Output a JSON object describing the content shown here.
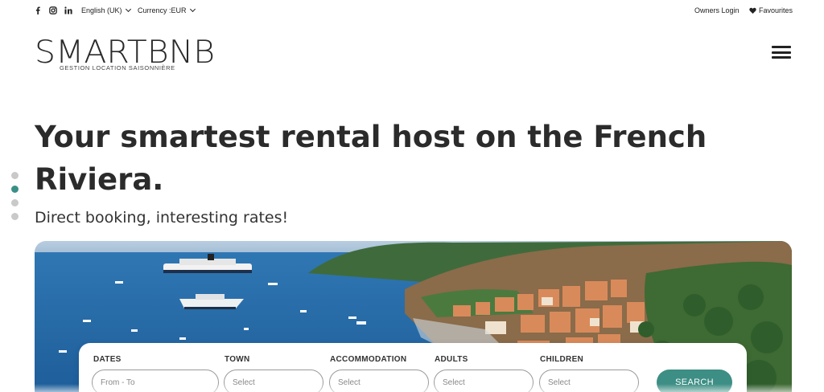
{
  "topbar": {
    "social_icons": [
      "facebook-icon",
      "instagram-icon",
      "linkedin-icon"
    ],
    "language": "English (UK)",
    "currency": "Currency :EUR",
    "owners_login": "Owners Login",
    "favourites": "Favourites"
  },
  "brand": {
    "name": "SMARTBNB",
    "tagline": "GESTION LOCATION SAISONNIÈRE"
  },
  "hero": {
    "title": "Your smartest rental host on the French Riviera.",
    "subtitle": "Direct booking, interesting rates!",
    "slide_count": 4,
    "active_slide": 2
  },
  "search": {
    "dates_label": "DATES",
    "dates_placeholder": "From - To",
    "town_label": "TOWN",
    "town_placeholder": "Select",
    "accommodation_label": "ACCOMMODATION",
    "accommodation_placeholder": "Select",
    "adults_label": "ADULTS",
    "adults_placeholder": "Select",
    "children_label": "CHILDREN",
    "children_placeholder": "Select",
    "button_label": "SEARCH"
  },
  "colors": {
    "accent": "#3d8e84",
    "dot_inactive": "#c9c9c9",
    "text": "#2b2b2b"
  }
}
